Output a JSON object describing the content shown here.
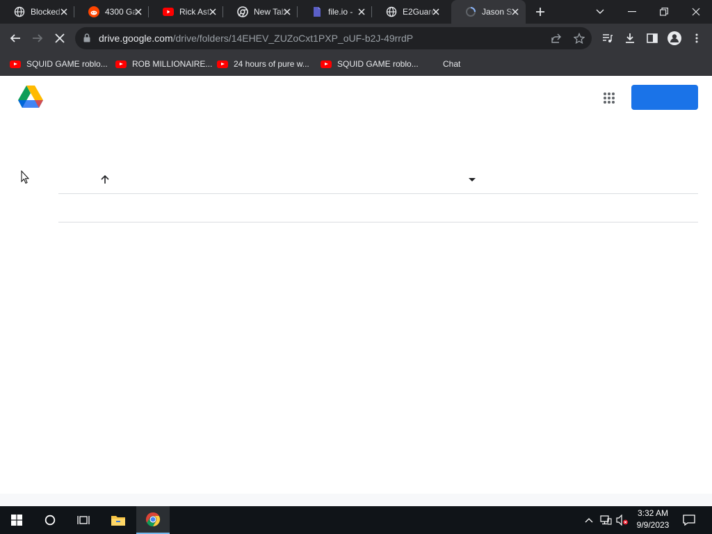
{
  "browser": {
    "tabs": [
      {
        "title": "Blocked",
        "icon": "globe-icon"
      },
      {
        "title": "4300 Ga",
        "icon": "reddit-icon"
      },
      {
        "title": "Rick Ast",
        "icon": "youtube-icon"
      },
      {
        "title": "New Tab",
        "icon": "chrome-icon"
      },
      {
        "title": "file.io - ",
        "icon": "fileio-icon"
      },
      {
        "title": "E2Guard",
        "icon": "globe-icon"
      },
      {
        "title": "Jason S",
        "icon": "loading-icon",
        "active": true
      }
    ],
    "url_host": "drive.google.com",
    "url_path": "/drive/folders/14EHEV_ZUZoCxt1PXP_oUF-b2J-49rrdP",
    "bookmarks": [
      {
        "label": "SQUID GAME roblo...",
        "icon": "youtube-icon"
      },
      {
        "label": "ROB MILLIONAIRE...",
        "icon": "youtube-icon"
      },
      {
        "label": "24 hours of pure w...",
        "icon": "youtube-icon"
      },
      {
        "label": "SQUID GAME roblo...",
        "icon": "youtube-icon"
      },
      {
        "label": "Chat",
        "icon": ""
      }
    ]
  },
  "page": {
    "logo": "google-drive-logo",
    "accent_color": "#1a73e8"
  },
  "taskbar": {
    "time": "3:32 AM",
    "date": "9/9/2023"
  }
}
